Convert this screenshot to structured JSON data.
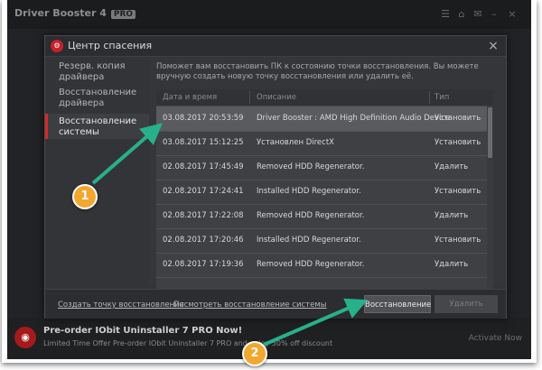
{
  "background_app": {
    "title": "Driver Booster 4",
    "badge": "PRO",
    "bottom_line1": "Pre-order IObit Uninstaller 7 PRO Now!",
    "bottom_line2": "Limited Time Offer Pre-order IObit Uninstaller 7 PRO and enjoy 50% off discount",
    "bottom_right": "Activate Now"
  },
  "dialog": {
    "title": "Центр спасения",
    "close_icon": "×",
    "sidebar": [
      {
        "label": "Резерв. копия драйвера",
        "active": false
      },
      {
        "label": "Восстановление драйвера",
        "active": false
      },
      {
        "label": "Восстановление системы",
        "active": true
      }
    ],
    "description": "Поможет вам восстановить ПК к состоянию точки восстановления. Вы можете вручную создать новую точку восстановления или удалить её.",
    "table": {
      "columns": [
        "Дата и время",
        "Описание",
        "Тип"
      ],
      "rows": [
        {
          "date": "03.08.2017 20:53:59",
          "desc": "Driver Booster : AMD High Definition Audio Device",
          "type": "Установить",
          "selected": true
        },
        {
          "date": "03.08.2017 15:12:25",
          "desc": "Установлен DirectX",
          "type": "Установить",
          "selected": false
        },
        {
          "date": "02.08.2017 17:45:49",
          "desc": "Removed HDD Regenerator.",
          "type": "Удалить",
          "selected": false
        },
        {
          "date": "02.08.2017 17:24:41",
          "desc": "Installed HDD Regenerator.",
          "type": "Установить",
          "selected": false
        },
        {
          "date": "02.08.2017 17:22:08",
          "desc": "Removed HDD Regenerator.",
          "type": "Удалить",
          "selected": false
        },
        {
          "date": "02.08.2017 17:20:46",
          "desc": "Installed HDD Regenerator.",
          "type": "Установить",
          "selected": false
        },
        {
          "date": "02.08.2017 17:19:36",
          "desc": "Removed HDD Regenerator.",
          "type": "Удалить",
          "selected": false
        }
      ]
    },
    "footer": {
      "create_link": "Создать точку восстановления",
      "view_link": "Посмотреть восстановление системы",
      "restore_button": "Восстановление",
      "delete_button": "Удалить"
    }
  },
  "callouts": [
    {
      "label": "1"
    },
    {
      "label": "2"
    }
  ],
  "colors": {
    "accent_red": "#d42a2a",
    "callout_orange": "#f2a72e",
    "arrow_teal": "#27b08a"
  }
}
